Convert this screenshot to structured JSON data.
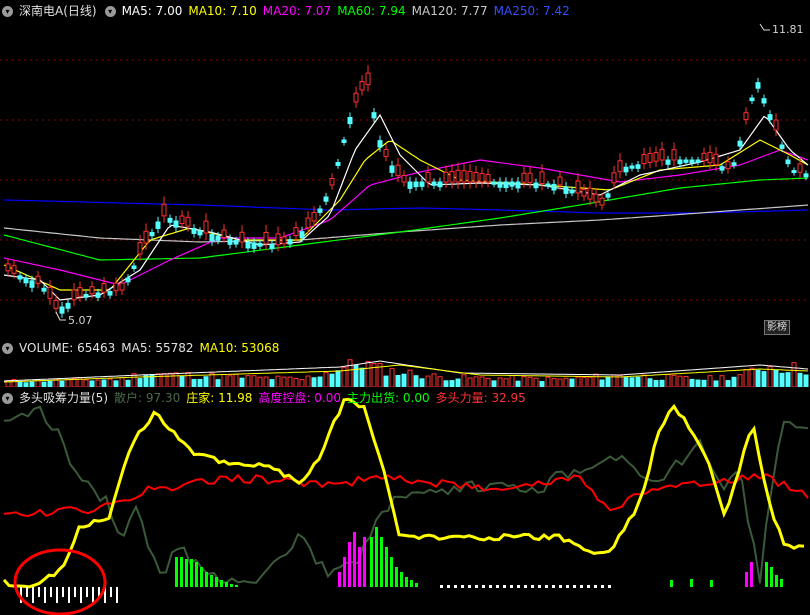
{
  "main": {
    "title": "深南电A(日线)",
    "ma": [
      {
        "label": "MA5: 7.00",
        "color": "#ffffff"
      },
      {
        "label": "MA10: 7.10",
        "color": "#ffff00"
      },
      {
        "label": "MA20: 7.07",
        "color": "#ff00ff"
      },
      {
        "label": "MA60: 7.94",
        "color": "#00ff00"
      },
      {
        "label": "MA120: 7.77",
        "color": "#c8c8c8"
      },
      {
        "label": "MA250: 7.42",
        "color": "#0000ff"
      }
    ],
    "high_label": "11.81",
    "low_label": "5.07",
    "badge": "影榜"
  },
  "volume": {
    "title": "VOLUME: 65463",
    "ma5": "MA5: 55782",
    "ma10": "MA10: 53068"
  },
  "indicator": {
    "title": "多头吸筹力量(5)",
    "items": [
      {
        "label": "散户: 97.30",
        "color": "#3a5a3a"
      },
      {
        "label": "庄家: 11.98",
        "color": "#ffff00"
      },
      {
        "label": "高度控盘: 0.00",
        "color": "#ff00ff"
      },
      {
        "label": "主力出货: 0.00",
        "color": "#00ff00"
      },
      {
        "label": "多头力量: 32.95",
        "color": "#ff0000"
      }
    ]
  },
  "colors": {
    "up": "#ff3030",
    "down": "#54ffff",
    "grid": "#8b0000",
    "annotation_circle": "#ff0000"
  }
}
